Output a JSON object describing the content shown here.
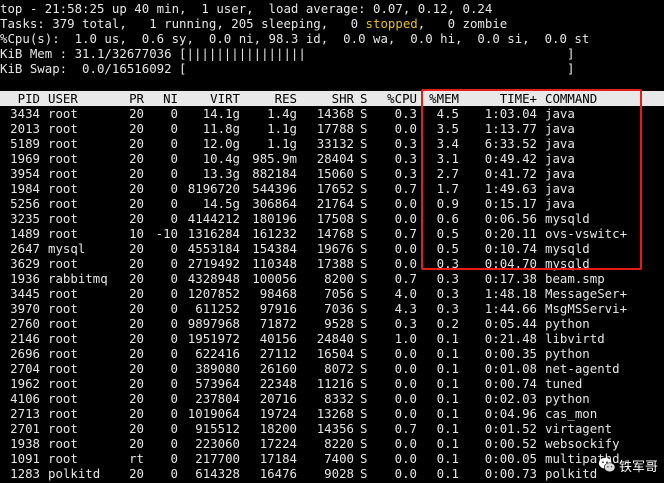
{
  "top_summary": {
    "line1": "top - 21:58:25 up 40 min,  1 user,  load average: 0.07, 0.12, 0.24",
    "tasks_pre": "Tasks: 379 total,   1 running, 205 sleeping,   0 ",
    "tasks_stopped": "stopped",
    "tasks_post": ",   0 zombie",
    "cpu": "%Cpu(s):  1.0 us,  0.6 sy,  0.0 ni, 98.3 id,  0.0 wa,  0.0 hi,  0.0 si,  0.0 st",
    "mem": "KiB Mem : 31.1/32677036 [||||||||||||||||                                   ]",
    "swap": "KiB Swap:  0.0/16516092 [                                                   ]"
  },
  "columns": {
    "pid": "PID",
    "user": "USER",
    "pr": "PR",
    "ni": "NI",
    "virt": "VIRT",
    "res": "RES",
    "shr": "SHR",
    "s": "S",
    "cpu": "%CPU",
    "mem": "%MEM",
    "time": "TIME+",
    "command": "COMMAND"
  },
  "processes": [
    {
      "pid": "3434",
      "user": "root",
      "pr": "20",
      "ni": "0",
      "virt": "14.1g",
      "res": "1.4g",
      "shr": "14368",
      "s": "S",
      "cpu": "0.3",
      "mem": "4.5",
      "time": "1:03.04",
      "command": "java"
    },
    {
      "pid": "2013",
      "user": "root",
      "pr": "20",
      "ni": "0",
      "virt": "11.8g",
      "res": "1.1g",
      "shr": "17788",
      "s": "S",
      "cpu": "0.0",
      "mem": "3.5",
      "time": "1:13.77",
      "command": "java"
    },
    {
      "pid": "5189",
      "user": "root",
      "pr": "20",
      "ni": "0",
      "virt": "12.0g",
      "res": "1.1g",
      "shr": "33132",
      "s": "S",
      "cpu": "0.3",
      "mem": "3.4",
      "time": "6:33.52",
      "command": "java"
    },
    {
      "pid": "1969",
      "user": "root",
      "pr": "20",
      "ni": "0",
      "virt": "10.4g",
      "res": "985.9m",
      "shr": "28404",
      "s": "S",
      "cpu": "0.3",
      "mem": "3.1",
      "time": "0:49.42",
      "command": "java"
    },
    {
      "pid": "3954",
      "user": "root",
      "pr": "20",
      "ni": "0",
      "virt": "13.3g",
      "res": "882184",
      "shr": "15060",
      "s": "S",
      "cpu": "0.3",
      "mem": "2.7",
      "time": "0:41.72",
      "command": "java"
    },
    {
      "pid": "1984",
      "user": "root",
      "pr": "20",
      "ni": "0",
      "virt": "8196720",
      "res": "544396",
      "shr": "17652",
      "s": "S",
      "cpu": "0.7",
      "mem": "1.7",
      "time": "1:49.63",
      "command": "java"
    },
    {
      "pid": "5256",
      "user": "root",
      "pr": "20",
      "ni": "0",
      "virt": "14.5g",
      "res": "306864",
      "shr": "21764",
      "s": "S",
      "cpu": "0.0",
      "mem": "0.9",
      "time": "0:15.17",
      "command": "java"
    },
    {
      "pid": "3235",
      "user": "root",
      "pr": "20",
      "ni": "0",
      "virt": "4144212",
      "res": "180196",
      "shr": "17508",
      "s": "S",
      "cpu": "0.0",
      "mem": "0.6",
      "time": "0:06.56",
      "command": "mysqld"
    },
    {
      "pid": "1489",
      "user": "root",
      "pr": "10",
      "ni": "-10",
      "virt": "1316284",
      "res": "161232",
      "shr": "14768",
      "s": "S",
      "cpu": "0.7",
      "mem": "0.5",
      "time": "0:20.11",
      "command": "ovs-vswitc+"
    },
    {
      "pid": "2647",
      "user": "mysql",
      "pr": "20",
      "ni": "0",
      "virt": "4553184",
      "res": "154384",
      "shr": "19676",
      "s": "S",
      "cpu": "0.0",
      "mem": "0.5",
      "time": "0:10.74",
      "command": "mysqld"
    },
    {
      "pid": "3629",
      "user": "root",
      "pr": "20",
      "ni": "0",
      "virt": "2719492",
      "res": "110348",
      "shr": "17388",
      "s": "S",
      "cpu": "0.0",
      "mem": "0.3",
      "time": "0:04.70",
      "command": "mysqld"
    },
    {
      "pid": "1936",
      "user": "rabbitmq",
      "pr": "20",
      "ni": "0",
      "virt": "4328948",
      "res": "100056",
      "shr": "8200",
      "s": "S",
      "cpu": "0.7",
      "mem": "0.3",
      "time": "0:17.38",
      "command": "beam.smp"
    },
    {
      "pid": "3445",
      "user": "root",
      "pr": "20",
      "ni": "0",
      "virt": "1207852",
      "res": "98468",
      "shr": "7056",
      "s": "S",
      "cpu": "4.0",
      "mem": "0.3",
      "time": "1:48.18",
      "command": "MessageSer+"
    },
    {
      "pid": "3970",
      "user": "root",
      "pr": "20",
      "ni": "0",
      "virt": "611252",
      "res": "97916",
      "shr": "7036",
      "s": "S",
      "cpu": "4.3",
      "mem": "0.3",
      "time": "1:44.66",
      "command": "MsgMSServi+"
    },
    {
      "pid": "2760",
      "user": "root",
      "pr": "20",
      "ni": "0",
      "virt": "9897968",
      "res": "71872",
      "shr": "9528",
      "s": "S",
      "cpu": "0.3",
      "mem": "0.2",
      "time": "0:05.44",
      "command": "python"
    },
    {
      "pid": "2146",
      "user": "root",
      "pr": "20",
      "ni": "0",
      "virt": "1951972",
      "res": "40156",
      "shr": "24840",
      "s": "S",
      "cpu": "1.0",
      "mem": "0.1",
      "time": "0:21.48",
      "command": "libvirtd"
    },
    {
      "pid": "2696",
      "user": "root",
      "pr": "20",
      "ni": "0",
      "virt": "622416",
      "res": "27112",
      "shr": "16504",
      "s": "S",
      "cpu": "0.0",
      "mem": "0.1",
      "time": "0:00.35",
      "command": "python"
    },
    {
      "pid": "2704",
      "user": "root",
      "pr": "20",
      "ni": "0",
      "virt": "389080",
      "res": "26160",
      "shr": "8072",
      "s": "S",
      "cpu": "0.0",
      "mem": "0.1",
      "time": "0:01.08",
      "command": "net-agentd"
    },
    {
      "pid": "1962",
      "user": "root",
      "pr": "20",
      "ni": "0",
      "virt": "573964",
      "res": "22348",
      "shr": "11216",
      "s": "S",
      "cpu": "0.0",
      "mem": "0.1",
      "time": "0:00.74",
      "command": "tuned"
    },
    {
      "pid": "4106",
      "user": "root",
      "pr": "20",
      "ni": "0",
      "virt": "237804",
      "res": "20716",
      "shr": "8332",
      "s": "S",
      "cpu": "0.0",
      "mem": "0.1",
      "time": "0:02.03",
      "command": "python"
    },
    {
      "pid": "2713",
      "user": "root",
      "pr": "20",
      "ni": "0",
      "virt": "1019064",
      "res": "19724",
      "shr": "13268",
      "s": "S",
      "cpu": "0.0",
      "mem": "0.1",
      "time": "0:04.96",
      "command": "cas_mon"
    },
    {
      "pid": "2701",
      "user": "root",
      "pr": "20",
      "ni": "0",
      "virt": "915512",
      "res": "18200",
      "shr": "14356",
      "s": "S",
      "cpu": "0.7",
      "mem": "0.1",
      "time": "0:01.52",
      "command": "virtagent"
    },
    {
      "pid": "1938",
      "user": "root",
      "pr": "20",
      "ni": "0",
      "virt": "223060",
      "res": "17224",
      "shr": "8220",
      "s": "S",
      "cpu": "0.0",
      "mem": "0.1",
      "time": "0:00.52",
      "command": "websockify"
    },
    {
      "pid": "1091",
      "user": "root",
      "pr": "rt",
      "ni": "0",
      "virt": "217700",
      "res": "17184",
      "shr": "7400",
      "s": "S",
      "cpu": "0.0",
      "mem": "0.1",
      "time": "0:00.05",
      "command": "multipathd"
    },
    {
      "pid": "1283",
      "user": "polkitd",
      "pr": "20",
      "ni": "0",
      "virt": "614328",
      "res": "16476",
      "shr": "9028",
      "s": "S",
      "cpu": "0.0",
      "mem": "0.1",
      "time": "0:00.73",
      "command": "polkitd"
    }
  ],
  "watermark": {
    "text": "铁军哥"
  },
  "colors": {
    "highlight": "#e51c1c",
    "stopped": "#e6c300",
    "header_bg": "#e8e8e8"
  }
}
